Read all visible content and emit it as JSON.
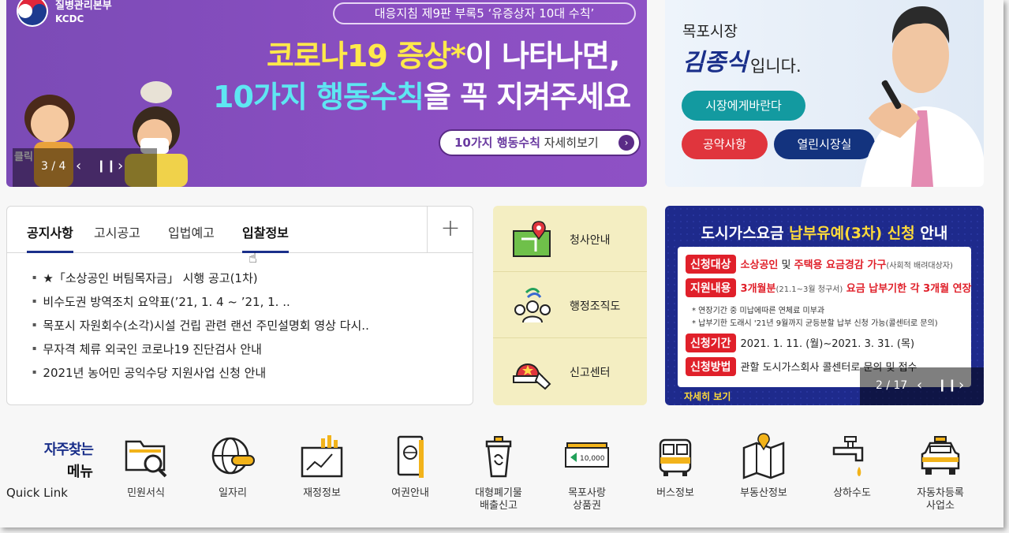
{
  "banner": {
    "org_name": "질병관리본부",
    "org_sub": "KCDC",
    "guide": "대응지침 제9판 부록5 ‘유증상자 10대 수칙’",
    "headline1_highlight": "코로나19 증상*",
    "headline1_rest": "이 나타나면,",
    "headline2_highlight": "10가지 행동수칙",
    "headline2_rest": "을 꼭 지켜주세요",
    "detail_highlight": "10가지 행동수칙",
    "detail_rest": " 자세히보기",
    "click_tag": "클릭",
    "counter": "3 / 4"
  },
  "mayor": {
    "title": "목포시장",
    "name": "김종식",
    "suffix": "입니다.",
    "btn_wish": "시장에게바란다",
    "btn_pledge": "공약사항",
    "btn_open": "열린시장실"
  },
  "notice": {
    "tabs": [
      "공지사항",
      "고시공고",
      "입법예고",
      "입찰정보"
    ],
    "plus": "+",
    "items": [
      "★「소상공인 버팀목자금」 시행 공고(1차)",
      "비수도권 방역조치 요약표(’21, 1. 4 ~ ’21, 1. ..",
      "목포시 자원회수(소각)시설 건립 관련 랜선 주민설명회 영상 다시..",
      "무자격 체류 외국인 코로나19 진단검사 안내",
      "2021년 농어민 공익수당 지원사업 신청 안내"
    ]
  },
  "services": [
    "청사안내",
    "행정조직도",
    "신고센터"
  ],
  "gas": {
    "title_white1": "도시가스요금 ",
    "title_yellow": "납부유예(3차) 신청",
    "title_white2": " 안내",
    "row1_tag": "신청대상",
    "row1_red": "소상공인",
    "row1_mid": " 및 ",
    "row1_red2": "주택용 요금경감 가구",
    "row1_small": "(사회적 배려대상자)",
    "row2_tag": "지원내용",
    "row2_red": "3개월분",
    "row2_small": "(21.1~3월 청구서)",
    "row2_red2": " 요금 납부기한 각 3개월 연장",
    "note1": "* 연장기간 중 미납에따른 연체료 미부과",
    "note2": "* 납부기한 도래시 '21년 9월까지 균등분할 납부 신청 가능(콜센터로 문의)",
    "row3_tag": "신청기간",
    "row3_text": "2021. 1. 11. (월)~2021. 3. 31. (목)",
    "row4_tag": "신청방법",
    "row4_text": "관할 도시가스회사 콜센터로 문의 및 접수",
    "more": "자세히 보기",
    "counter": "2 / 17"
  },
  "quicklink": {
    "title1": "자주찾는",
    "title2": "메뉴",
    "title3": "Quick Link",
    "items": [
      {
        "label": "민원서식",
        "icon": "folder-search-icon"
      },
      {
        "label": "일자리",
        "icon": "globe-search-icon"
      },
      {
        "label": "재정정보",
        "icon": "finance-chart-icon"
      },
      {
        "label": "여권안내",
        "icon": "passport-icon"
      },
      {
        "label": "대형폐기물\n배출신고",
        "icon": "trash-bin-icon"
      },
      {
        "label": "목포사랑\n상품권",
        "icon": "gift-voucher-icon"
      },
      {
        "label": "버스정보",
        "icon": "bus-icon"
      },
      {
        "label": "부동산정보",
        "icon": "map-pin-icon"
      },
      {
        "label": "상하수도",
        "icon": "water-tap-icon"
      },
      {
        "label": "자동차등록\n사업소",
        "icon": "car-icon"
      }
    ]
  }
}
